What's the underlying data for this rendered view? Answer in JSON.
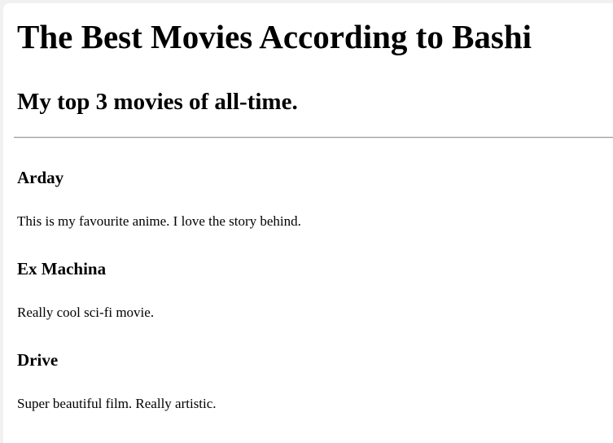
{
  "page": {
    "title": "The Best Movies According to Bashi",
    "subtitle": "My top 3 movies of all-time."
  },
  "movies": [
    {
      "title": "Arday",
      "description": "This is my favourite anime. I love the story behind."
    },
    {
      "title": "Ex Machina",
      "description": "Really cool sci-fi movie."
    },
    {
      "title": "Drive",
      "description": "Super beautiful film. Really artistic."
    }
  ]
}
